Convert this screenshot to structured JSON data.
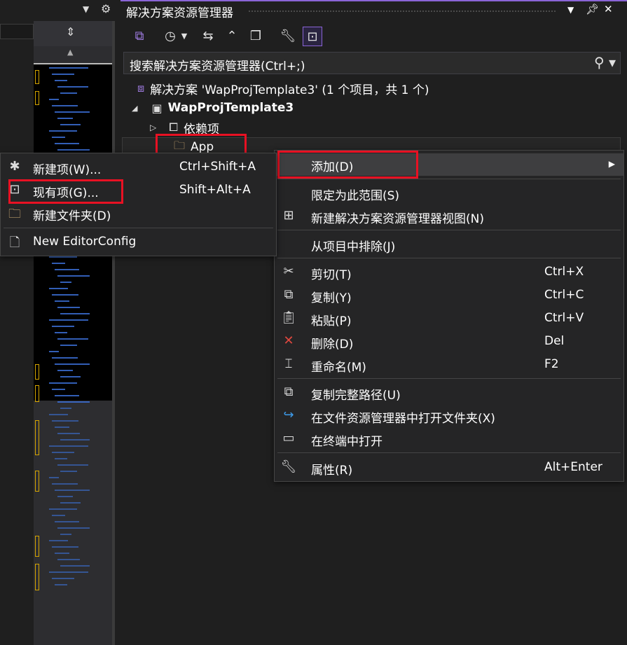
{
  "explorer": {
    "title": "解决方案资源管理器",
    "search_placeholder": "搜索解决方案资源管理器(Ctrl+;)"
  },
  "tree": {
    "solution_label": "解决方案 'WapProjTemplate3' (1 个项目，共 1 个)",
    "project_label": "WapProjTemplate3",
    "dependencies_label": "依赖项",
    "app_folder_label": "App"
  },
  "context_menu": {
    "add": "添加(D)",
    "scope": "限定为此范围(S)",
    "new_view": "新建解决方案资源管理器视图(N)",
    "exclude": "从项目中排除(J)",
    "cut": "剪切(T)",
    "cut_shortcut": "Ctrl+X",
    "copy": "复制(Y)",
    "copy_shortcut": "Ctrl+C",
    "paste": "粘贴(P)",
    "paste_shortcut": "Ctrl+V",
    "delete": "删除(D)",
    "delete_shortcut": "Del",
    "rename": "重命名(M)",
    "rename_shortcut": "F2",
    "copy_path": "复制完整路径(U)",
    "open_in_explorer": "在文件资源管理器中打开文件夹(X)",
    "open_in_terminal": "在终端中打开",
    "properties": "属性(R)",
    "properties_shortcut": "Alt+Enter"
  },
  "add_submenu": {
    "new_item": "新建项(W)...",
    "new_item_shortcut": "Ctrl+Shift+A",
    "existing_item": "现有项(G)...",
    "existing_item_shortcut": "Shift+Alt+A",
    "new_folder": "新建文件夹(D)",
    "editorconfig": "New EditorConfig"
  },
  "colors": {
    "background": "#1f1f1f",
    "menu_background": "#252526",
    "highlight_border": "#e81123",
    "accent": "#8a64d6"
  }
}
